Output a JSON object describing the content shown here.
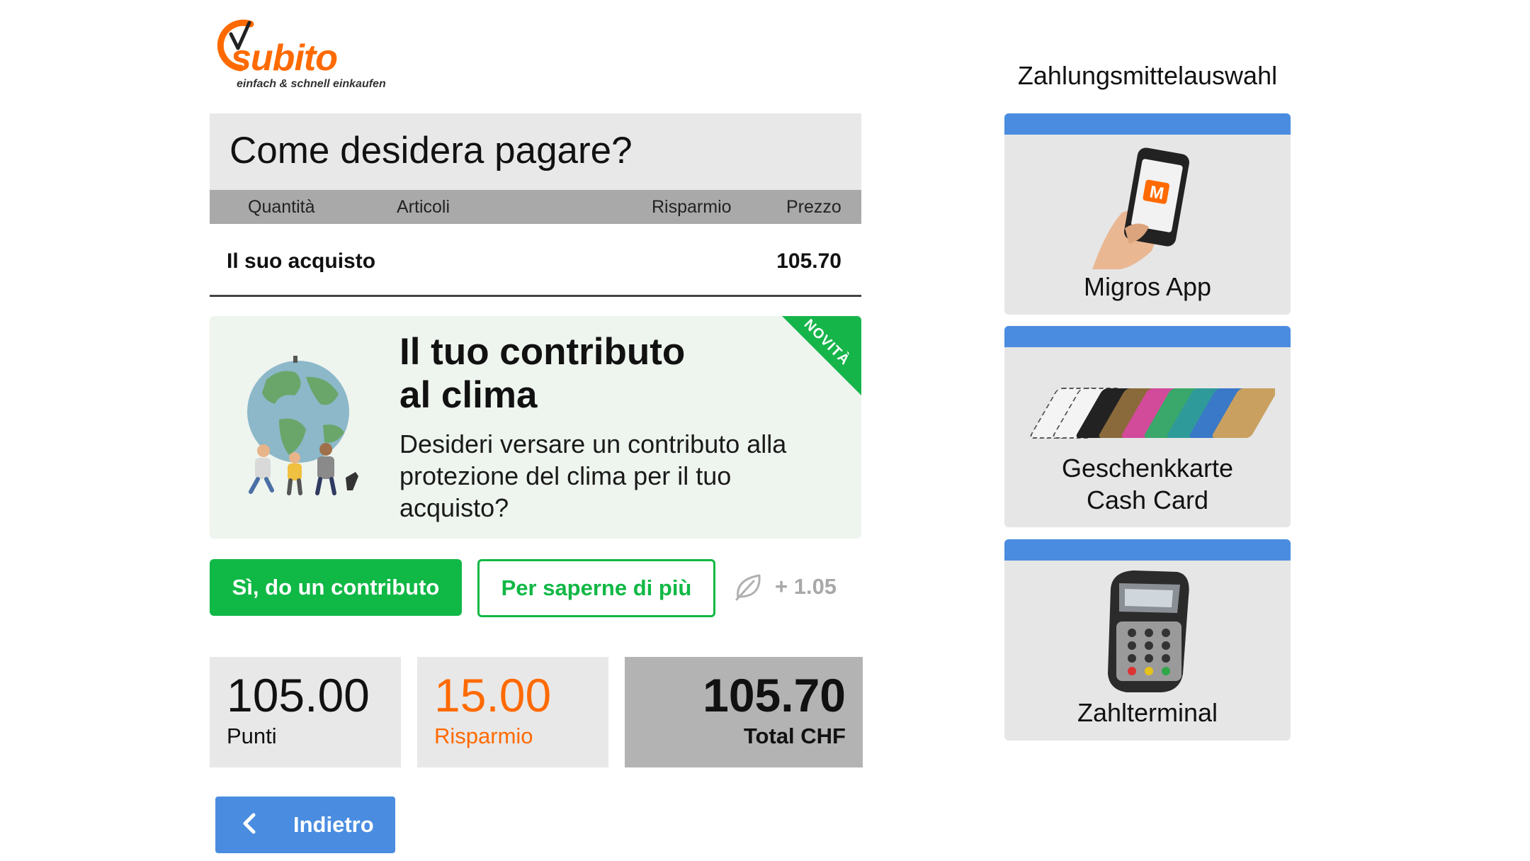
{
  "logo": {
    "brand": "subito",
    "tagline": "einfach & schnell einkaufen",
    "brand_color": "#ff6a00"
  },
  "header": {
    "title": "Come desidera pagare?"
  },
  "table": {
    "columns": [
      "Quantità",
      "Articoli",
      "Risparmio",
      "Prezzo"
    ],
    "rows": [
      {
        "label": "Il suo acquisto",
        "price": "105.70"
      }
    ]
  },
  "climate": {
    "badge": "NOVITÀ",
    "title_line1": "Il tuo contributo",
    "title_line2": "al clima",
    "description": "Desideri versare un contributo alla protezione del clima per il tuo acquisto?",
    "contribute_label": "Sì, do un contributo",
    "learn_more_label": "Per saperne di più",
    "amount": "+ 1.05",
    "leaf_icon": "leaf-icon",
    "accent_color": "#10b845"
  },
  "totals": {
    "points_value": "105.00",
    "points_label": "Punti",
    "savings_value": "15.00",
    "savings_label": "Risparmio",
    "total_value": "105.70",
    "total_label": "Total CHF"
  },
  "back": {
    "label": "Indietro",
    "icon": "chevron-left-icon"
  },
  "payment": {
    "title": "Zahlungsmittelauswahl",
    "options": [
      {
        "label": "Migros App",
        "icon": "phone-app-icon"
      },
      {
        "label_line1": "Geschenkkarte",
        "label_line2": "Cash Card",
        "icon": "gift-cards-icon"
      },
      {
        "label": "Zahlterminal",
        "icon": "card-terminal-icon"
      }
    ],
    "tile_accent": "#4a8de0"
  }
}
